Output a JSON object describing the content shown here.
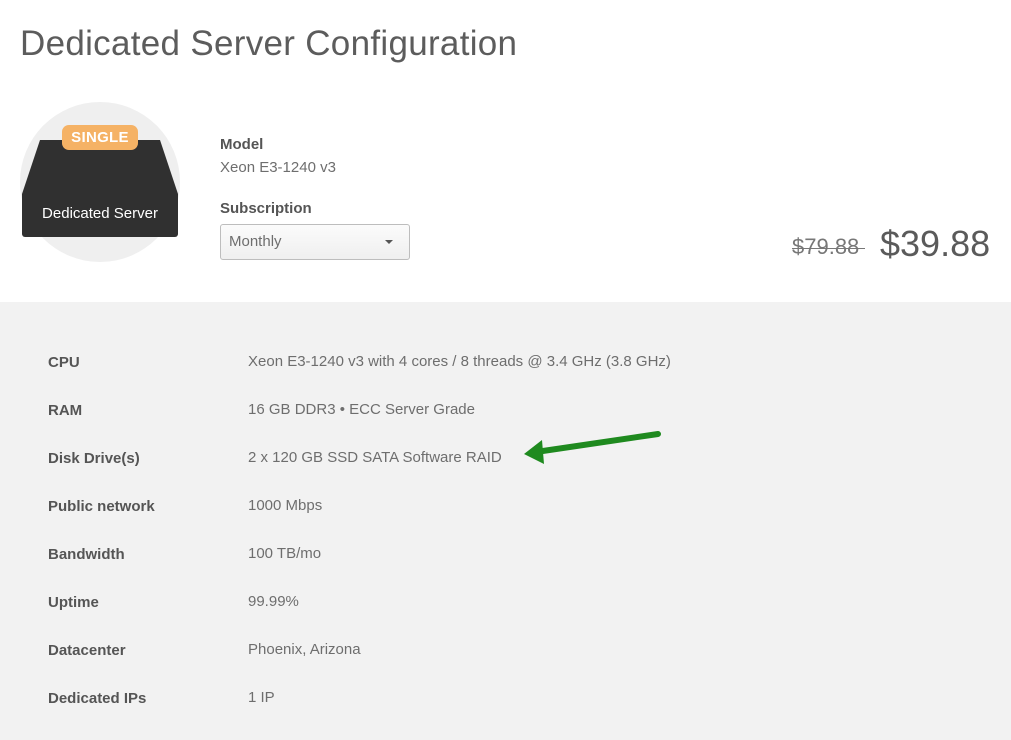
{
  "page": {
    "title": "Dedicated Server Configuration"
  },
  "product_badge": {
    "tag": "SINGLE",
    "name": "Dedicated Server"
  },
  "model": {
    "label": "Model",
    "value": "Xeon E3-1240 v3"
  },
  "subscription": {
    "label": "Subscription",
    "selected": "Monthly"
  },
  "pricing": {
    "old_price": "$79.88",
    "new_price": "$39.88"
  },
  "specs": [
    {
      "label": "CPU",
      "value": "Xeon E3-1240 v3 with 4 cores / 8 threads @ 3.4 GHz (3.8 GHz)"
    },
    {
      "label": "RAM",
      "value": "16 GB DDR3 • ECC Server Grade"
    },
    {
      "label": "Disk Drive(s)",
      "value": "2 x 120 GB SSD SATA Software RAID"
    },
    {
      "label": "Public network",
      "value": "1000 Mbps"
    },
    {
      "label": "Bandwidth",
      "value": "100 TB/mo"
    },
    {
      "label": "Uptime",
      "value": "99.99%"
    },
    {
      "label": "Datacenter",
      "value": "Phoenix, Arizona"
    },
    {
      "label": "Dedicated IPs",
      "value": "1 IP"
    }
  ],
  "colors": {
    "badge_orange": "#f5b265",
    "server_dark": "#303030",
    "annotation_arrow": "#1f8a1f",
    "spec_background": "#f2f2f2"
  },
  "icons": {
    "server": "server-icon",
    "dropdown": "caret-down-icon",
    "annotation": "arrow-icon"
  }
}
